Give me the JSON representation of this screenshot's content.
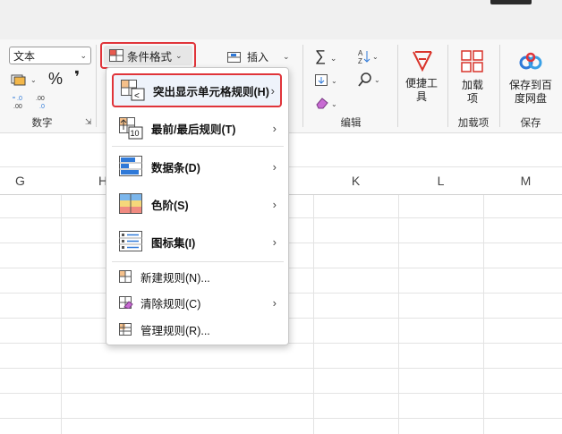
{
  "ribbon": {
    "number_format_value": "文本",
    "number_group_label": "数字",
    "conditional_format_label": "条件格式",
    "insert_label": "插入",
    "edit_group_label": "编辑",
    "convenience_tools_label": "便捷工具",
    "addins_button_label": "加载项",
    "addins_group_label": "加载项",
    "save_to_baidu_label": "保存到百度网盘",
    "save_group_label": "保存",
    "percent_symbol": "%",
    "comma_symbol": "❜",
    "sigma_symbol": "∑",
    "sort_symbol": "A/Z"
  },
  "columns": [
    "G",
    "H",
    "K",
    "L",
    "M"
  ],
  "menu": {
    "items": [
      {
        "label": "突出显示单元格规则(H)",
        "submenu": true,
        "highlighted": true
      },
      {
        "label": "最前/最后规则(T)",
        "submenu": true
      },
      {
        "label": "数据条(D)",
        "submenu": true
      },
      {
        "label": "色阶(S)",
        "submenu": true
      },
      {
        "label": "图标集(I)",
        "submenu": true
      },
      {
        "label": "新建规则(N)...",
        "submenu": false
      },
      {
        "label": "清除规则(C)",
        "submenu": true
      },
      {
        "label": "管理规则(R)...",
        "submenu": false
      }
    ],
    "top10_icon_text": "10"
  },
  "colors": {
    "highlight_border": "#e0343a",
    "accent_red": "#d9342b",
    "blue": "#2f79d8"
  }
}
